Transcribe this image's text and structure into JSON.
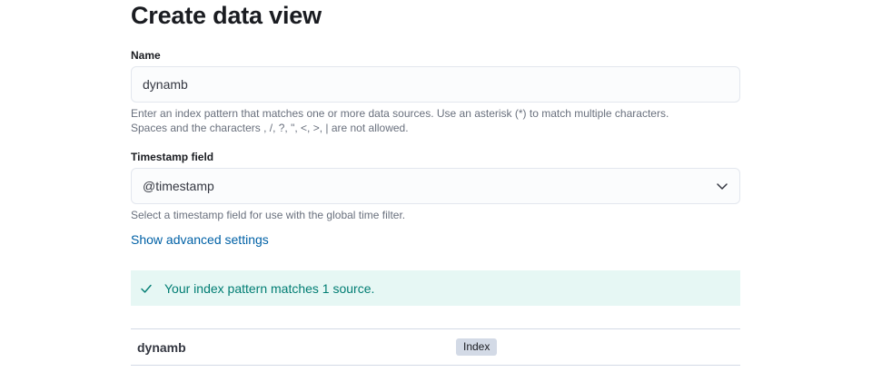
{
  "page": {
    "title": "Create data view"
  },
  "name_field": {
    "label": "Name",
    "value": "dynamb",
    "help_line1": "Enter an index pattern that matches one or more data sources. Use an asterisk (*) to match multiple characters.",
    "help_line2": "Spaces and the characters , /, ?, \", <, >, | are not allowed."
  },
  "timestamp_field": {
    "label": "Timestamp field",
    "selected": "@timestamp",
    "help": "Select a timestamp field for use with the global time filter."
  },
  "advanced": {
    "link_label": "Show advanced settings"
  },
  "match_callout": {
    "message": "Your index pattern matches 1 source.",
    "color": "#017d73"
  },
  "sources_table": {
    "rows": [
      {
        "name": "dynamb",
        "type": "Index"
      }
    ]
  },
  "colors": {
    "accent_link": "#0061a6",
    "success_bg": "#e6f7f4"
  }
}
